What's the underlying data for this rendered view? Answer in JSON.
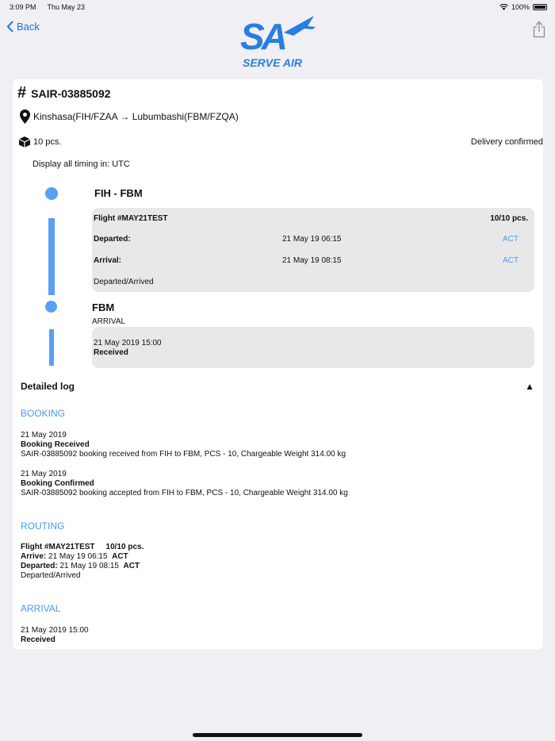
{
  "status_bar": {
    "time": "3:09 PM",
    "date": "Thu May 23",
    "battery": "100%"
  },
  "nav": {
    "back_label": "Back",
    "logo_initials": "SA",
    "logo_text": "SERVE AIR"
  },
  "shipment": {
    "awb": "SAIR-03885092",
    "route": "Kinshasa(FIH/FZAA → Lubumbashi(FBM/FZQA)",
    "pieces": "10 pcs.",
    "status": "Delivery confirmed",
    "timezone_note": "Display all timing in: UTC"
  },
  "timeline": {
    "segment_title": "FIH - FBM",
    "flight": {
      "label": "Flight #MAY21TEST",
      "pieces": "10/10 pcs.",
      "departed_label": "Departed:",
      "departed_time": "21 May 19 06:15",
      "departed_status": "ACT",
      "arrival_label": "Arrival:",
      "arrival_time": "21 May 19 08:15",
      "arrival_status": "ACT",
      "state": "Departed/Arrived"
    },
    "destination": {
      "code": "FBM",
      "type": "ARRIVAL",
      "time": "21 May 2019 15:00",
      "state": "Received"
    }
  },
  "detailed_log": {
    "title": "Detailed log",
    "toggle_glyph": "▲",
    "booking": {
      "title": "BOOKING",
      "entries": [
        {
          "date": "21 May 2019",
          "event": "Booking Received",
          "detail": "SAIR-03885092 booking received from FIH to FBM, PCS - 10, Chargeable Weight 314.00 kg"
        },
        {
          "date": "21 May 2019",
          "event": "Booking Confirmed",
          "detail": "SAIR-03885092 booking accepted from FIH to FBM, PCS - 10, Chargeable Weight 314.00 kg"
        }
      ]
    },
    "routing": {
      "title": "ROUTING",
      "flight": "Flight #MAY21TEST",
      "pieces": "10/10 pcs.",
      "arrive_label": "Arrive:",
      "arrive_time": "21 May 19 06:15",
      "arrive_status": "ACT",
      "departed_label": "Departed:",
      "departed_time": "21 May 19 08:15",
      "departed_status": "ACT",
      "state": "Departed/Arrived"
    },
    "arrival": {
      "title": "ARRIVAL",
      "date": "21 May 2019 15:00",
      "state": "Received"
    }
  },
  "colors": {
    "accent": "#4a98f0",
    "timeline": "#5aa0f2",
    "link": "#1a6ff0",
    "logo": "#2a7de1"
  }
}
